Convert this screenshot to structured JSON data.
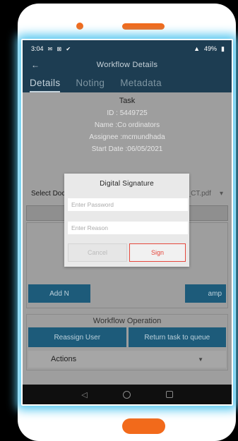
{
  "status": {
    "time": "3:04",
    "icons": "✉ ⊠ ✔",
    "battery": "49%"
  },
  "appbar": {
    "title": "Workflow Details",
    "back": "←"
  },
  "tabs": [
    {
      "label": "Details"
    },
    {
      "label": "Noting"
    },
    {
      "label": "Metadata"
    }
  ],
  "task": {
    "title": "Task",
    "id": "ID : 5449725",
    "name": "Name :Co ordinators",
    "assignee": "Assignee :mcmundhada",
    "start_date": "Start Date :06/05/2021"
  },
  "select_document": {
    "label": "Select Document",
    "file": "WM_Sample_CT.pdf"
  },
  "buttons": {
    "add": "Add N",
    "stamp": "amp"
  },
  "workflow": {
    "title": "Workflow Operation",
    "reassign": "Reassign User",
    "return": "Return task to queue",
    "actions": "Actions"
  },
  "dialog": {
    "title": "Digital Signature",
    "password_placeholder": "Enter Password",
    "reason_placeholder": "Enter Reason",
    "cancel": "Cancel",
    "sign": "Sign"
  },
  "colors": {
    "accent": "#1d3d52",
    "brand": "#f26a1b",
    "danger": "#e6473c",
    "button": "#1d5b7a"
  }
}
